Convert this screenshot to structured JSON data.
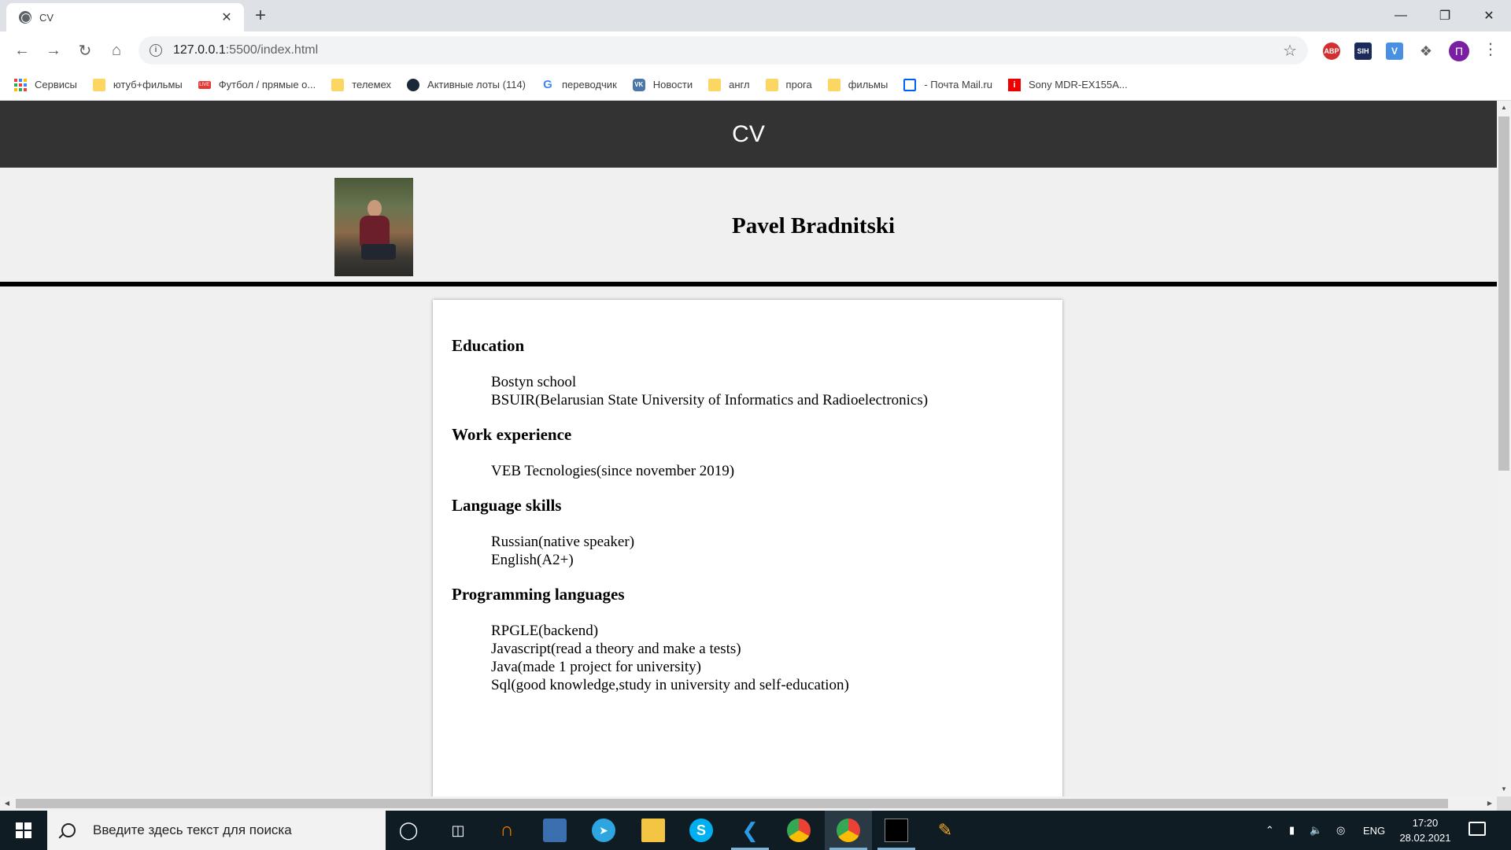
{
  "browser": {
    "tab_title": "CV",
    "tab_close": "✕",
    "new_tab": "+",
    "url_host": "127.0.0.1",
    "url_path": ":5500/index.html",
    "window_controls": {
      "minimize": "—",
      "restore": "❐",
      "close": "✕"
    },
    "profile_initial": "П",
    "extensions": [
      {
        "label": "ABP",
        "color": "#d32f2f"
      },
      {
        "label": "SIH",
        "color": "#1a2a5a"
      },
      {
        "label": "V",
        "color": "#4a90e2"
      }
    ]
  },
  "bookmarks": [
    {
      "label": "Сервисы",
      "icon": "apps-icon"
    },
    {
      "label": "ютуб+фильмы",
      "icon": "folder-icon"
    },
    {
      "label": "Футбол / прямые о...",
      "icon": "live-icon"
    },
    {
      "label": "телемех",
      "icon": "folder-icon"
    },
    {
      "label": "Активные лоты (114)",
      "icon": "steam-icon"
    },
    {
      "label": "переводчик",
      "icon": "google-icon"
    },
    {
      "label": "Новости",
      "icon": "vk-icon"
    },
    {
      "label": "англ",
      "icon": "folder-icon"
    },
    {
      "label": "прога",
      "icon": "folder-icon"
    },
    {
      "label": "фильмы",
      "icon": "folder-icon"
    },
    {
      "label": "- Почта Mail.ru",
      "icon": "mail-icon"
    },
    {
      "label": "Sony MDR-EX155A...",
      "icon": "info-red-icon"
    }
  ],
  "page": {
    "header_title": "CV",
    "name": "Pavel Bradnitski",
    "sections": [
      {
        "title": "Education",
        "items": [
          "Bostyn school",
          "BSUIR(Belarusian State University of Informatics and Radioelectronics)"
        ]
      },
      {
        "title": "Work experience",
        "items": [
          "VEB Tecnologies(since november 2019)"
        ]
      },
      {
        "title": "Language skills",
        "items": [
          "Russian(native speaker)",
          "English(A2+)"
        ]
      },
      {
        "title": "Programming languages",
        "items": [
          "RPGLE(backend)",
          "Javascript(read a theory and make a tests)",
          "Java(made 1 project for university)",
          "Sql(good knowledge,study in university and self-education)"
        ]
      }
    ]
  },
  "taskbar": {
    "search_placeholder": "Введите здесь текст для поиска",
    "language": "ENG",
    "time": "17:20",
    "date": "28.02.2021"
  }
}
